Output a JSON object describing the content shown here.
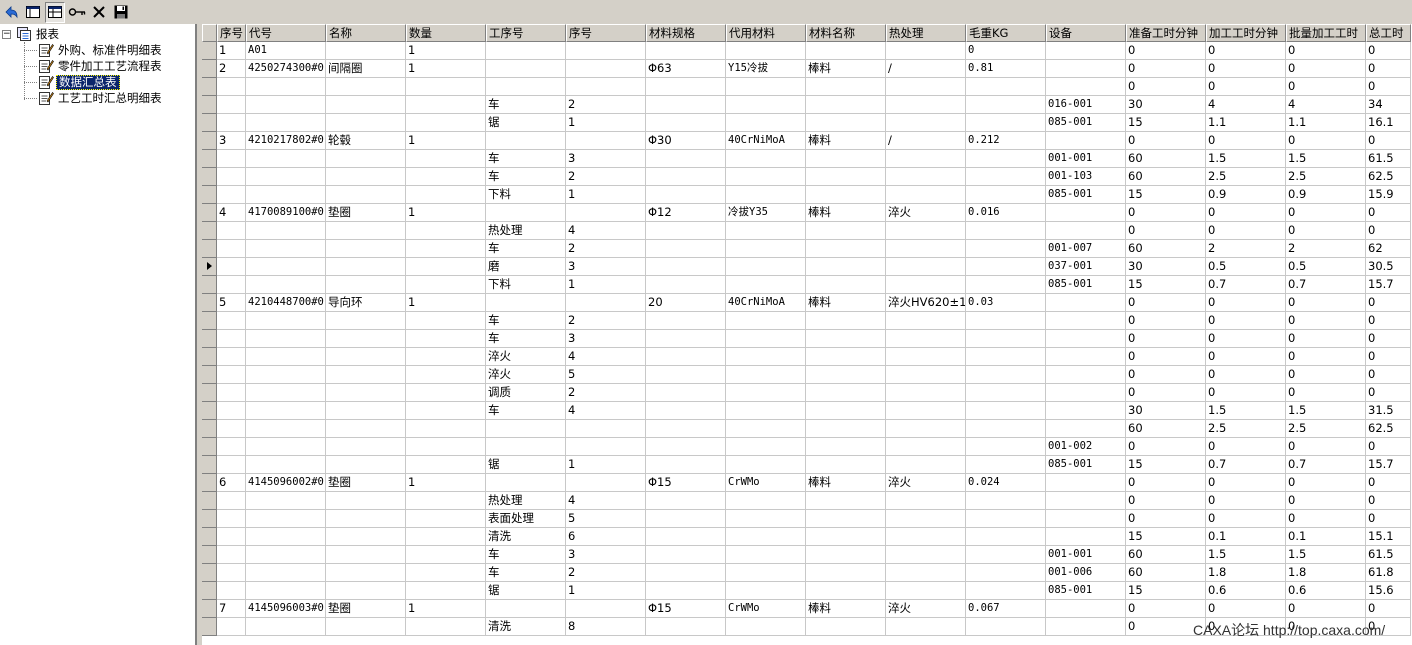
{
  "toolbar": {
    "buttons": [
      {
        "name": "back-icon"
      },
      {
        "name": "view-list-icon"
      },
      {
        "name": "view-table-icon"
      },
      {
        "name": "key-icon"
      },
      {
        "name": "close-icon"
      },
      {
        "name": "save-icon"
      }
    ]
  },
  "tree": {
    "root": {
      "label": "报表",
      "expander": "−"
    },
    "items": [
      {
        "label": "外购、标准件明细表",
        "selected": false
      },
      {
        "label": "零件加工工艺流程表",
        "selected": false
      },
      {
        "label": "数据汇总表",
        "selected": true
      },
      {
        "label": "工艺工时汇总明细表",
        "selected": false
      }
    ]
  },
  "grid": {
    "columns": [
      "序号",
      "代号",
      "名称",
      "数量",
      "工序号",
      "序号",
      "材料规格",
      "代用材料",
      "材料名称",
      "热处理",
      "毛重KG",
      "设备",
      "准备工时分钟",
      "加工工时分钟",
      "批量加工工时",
      "总工时"
    ],
    "current_row": 12,
    "rows": [
      [
        "1",
        "A01",
        "",
        "1",
        "",
        "",
        "",
        "",
        "",
        "",
        "0",
        "",
        "0",
        "0",
        "0",
        "0"
      ],
      [
        "2",
        "4250274300#0",
        "间隔圈",
        "1",
        "",
        "",
        "Φ63",
        "Y15冷拔",
        "棒料",
        "/",
        "0.81",
        "",
        "0",
        "0",
        "0",
        "0"
      ],
      [
        "",
        "",
        "",
        "",
        "",
        "",
        "",
        "",
        "",
        "",
        "",
        "",
        "0",
        "0",
        "0",
        "0"
      ],
      [
        "",
        "",
        "",
        "",
        "车",
        "2",
        "",
        "",
        "",
        "",
        "",
        "016-001",
        "30",
        "4",
        "4",
        "34"
      ],
      [
        "",
        "",
        "",
        "",
        "锯",
        "1",
        "",
        "",
        "",
        "",
        "",
        "085-001",
        "15",
        "1.1",
        "1.1",
        "16.1"
      ],
      [
        "3",
        "4210217802#0",
        "轮毂",
        "1",
        "",
        "",
        "Φ30",
        "40CrNiMoA",
        "棒料",
        "/",
        "0.212",
        "",
        "0",
        "0",
        "0",
        "0"
      ],
      [
        "",
        "",
        "",
        "",
        "车",
        "3",
        "",
        "",
        "",
        "",
        "",
        "001-001",
        "60",
        "1.5",
        "1.5",
        "61.5"
      ],
      [
        "",
        "",
        "",
        "",
        "车",
        "2",
        "",
        "",
        "",
        "",
        "",
        "001-103",
        "60",
        "2.5",
        "2.5",
        "62.5"
      ],
      [
        "",
        "",
        "",
        "",
        "下料",
        "1",
        "",
        "",
        "",
        "",
        "",
        "085-001",
        "15",
        "0.9",
        "0.9",
        "15.9"
      ],
      [
        "4",
        "4170089100#0",
        "垫圈",
        "1",
        "",
        "",
        "Φ12",
        "冷拔Y35",
        "棒料",
        "淬火",
        "0.016",
        "",
        "0",
        "0",
        "0",
        "0"
      ],
      [
        "",
        "",
        "",
        "",
        "热处理",
        "4",
        "",
        "",
        "",
        "",
        "",
        "",
        "0",
        "0",
        "0",
        "0"
      ],
      [
        "",
        "",
        "",
        "",
        "车",
        "2",
        "",
        "",
        "",
        "",
        "",
        "001-007",
        "60",
        "2",
        "2",
        "62"
      ],
      [
        "",
        "",
        "",
        "",
        "磨",
        "3",
        "",
        "",
        "",
        "",
        "",
        "037-001",
        "30",
        "0.5",
        "0.5",
        "30.5"
      ],
      [
        "",
        "",
        "",
        "",
        "下料",
        "1",
        "",
        "",
        "",
        "",
        "",
        "085-001",
        "15",
        "0.7",
        "0.7",
        "15.7"
      ],
      [
        "5",
        "4210448700#0",
        "导向环",
        "1",
        "",
        "",
        "20",
        "40CrNiMoA",
        "棒料",
        "淬火HV620±1",
        "0.03",
        "",
        "0",
        "0",
        "0",
        "0"
      ],
      [
        "",
        "",
        "",
        "",
        "车",
        "2",
        "",
        "",
        "",
        "",
        "",
        "",
        "0",
        "0",
        "0",
        "0"
      ],
      [
        "",
        "",
        "",
        "",
        "车",
        "3",
        "",
        "",
        "",
        "",
        "",
        "",
        "0",
        "0",
        "0",
        "0"
      ],
      [
        "",
        "",
        "",
        "",
        "淬火",
        "4",
        "",
        "",
        "",
        "",
        "",
        "",
        "0",
        "0",
        "0",
        "0"
      ],
      [
        "",
        "",
        "",
        "",
        "淬火",
        "5",
        "",
        "",
        "",
        "",
        "",
        "",
        "0",
        "0",
        "0",
        "0"
      ],
      [
        "",
        "",
        "",
        "",
        "调质",
        "2",
        "",
        "",
        "",
        "",
        "",
        "",
        "0",
        "0",
        "0",
        "0"
      ],
      [
        "",
        "",
        "",
        "",
        "车",
        "4",
        "",
        "",
        "",
        "",
        "",
        "",
        "30",
        "1.5",
        "1.5",
        "31.5"
      ],
      [
        "",
        "",
        "",
        "",
        "",
        "",
        "",
        "",
        "",
        "",
        "",
        "",
        "60",
        "2.5",
        "2.5",
        "62.5"
      ],
      [
        "",
        "",
        "",
        "",
        "",
        "",
        "",
        "",
        "",
        "",
        "",
        "001-002",
        "0",
        "0",
        "0",
        "0"
      ],
      [
        "",
        "",
        "",
        "",
        "锯",
        "1",
        "",
        "",
        "",
        "",
        "",
        "085-001",
        "15",
        "0.7",
        "0.7",
        "15.7"
      ],
      [
        "6",
        "4145096002#0",
        "垫圈",
        "1",
        "",
        "",
        "Φ15",
        "CrWMo",
        "棒料",
        "淬火",
        "0.024",
        "",
        "0",
        "0",
        "0",
        "0"
      ],
      [
        "",
        "",
        "",
        "",
        "热处理",
        "4",
        "",
        "",
        "",
        "",
        "",
        "",
        "0",
        "0",
        "0",
        "0"
      ],
      [
        "",
        "",
        "",
        "",
        "表面处理",
        "5",
        "",
        "",
        "",
        "",
        "",
        "",
        "0",
        "0",
        "0",
        "0"
      ],
      [
        "",
        "",
        "",
        "",
        "清洗",
        "6",
        "",
        "",
        "",
        "",
        "",
        "",
        "15",
        "0.1",
        "0.1",
        "15.1"
      ],
      [
        "",
        "",
        "",
        "",
        "车",
        "3",
        "",
        "",
        "",
        "",
        "",
        "001-001",
        "60",
        "1.5",
        "1.5",
        "61.5"
      ],
      [
        "",
        "",
        "",
        "",
        "车",
        "2",
        "",
        "",
        "",
        "",
        "",
        "001-006",
        "60",
        "1.8",
        "1.8",
        "61.8"
      ],
      [
        "",
        "",
        "",
        "",
        "锯",
        "1",
        "",
        "",
        "",
        "",
        "",
        "085-001",
        "15",
        "0.6",
        "0.6",
        "15.6"
      ],
      [
        "7",
        "4145096003#0",
        "垫圈",
        "1",
        "",
        "",
        "Φ15",
        "CrWMo",
        "棒料",
        "淬火",
        "0.067",
        "",
        "0",
        "0",
        "0",
        "0"
      ],
      [
        "",
        "",
        "",
        "",
        "清洗",
        "8",
        "",
        "",
        "",
        "",
        "",
        "",
        "0",
        "0",
        "0",
        "0"
      ]
    ]
  },
  "watermark": "CAXA论坛 http://top.caxa.com/"
}
